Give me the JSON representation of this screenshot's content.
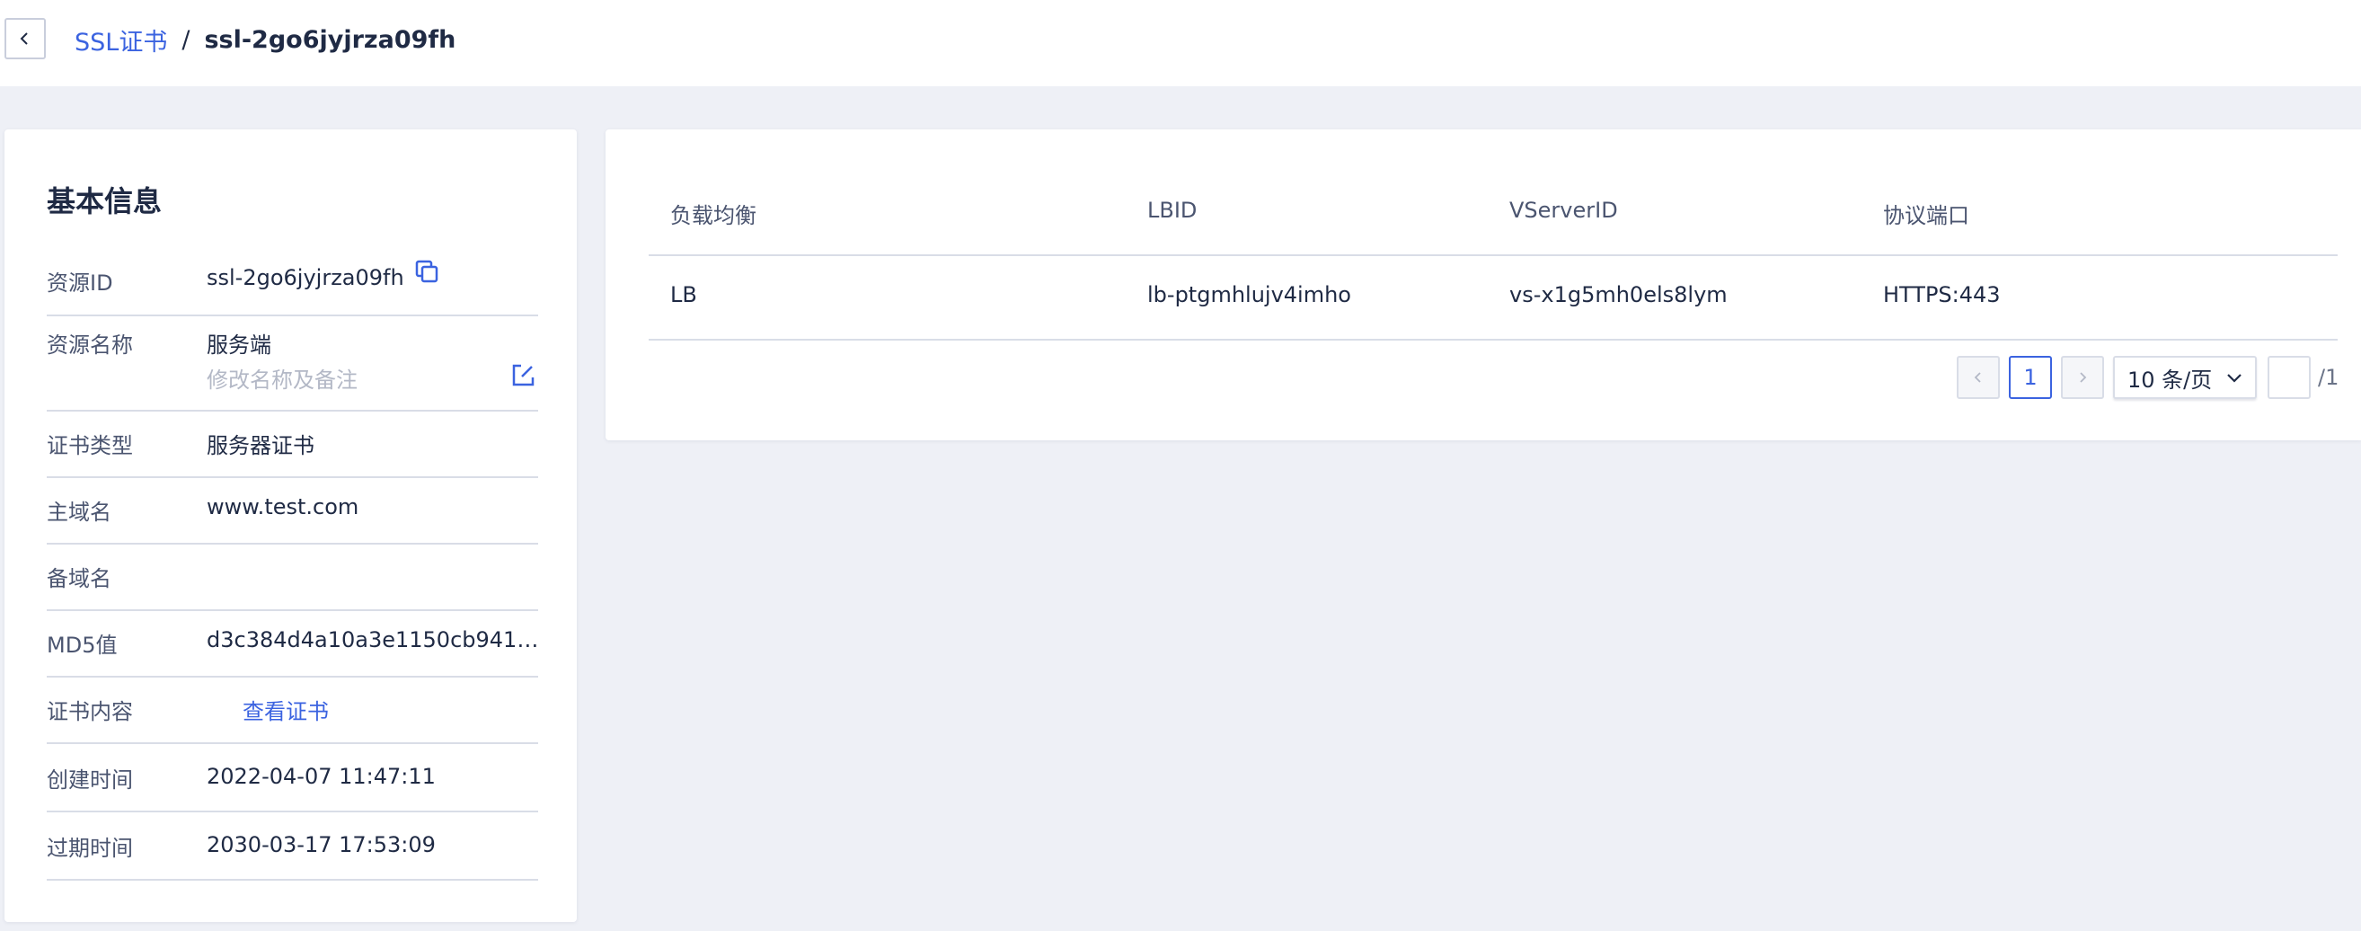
{
  "header": {
    "back_icon": "chevron-left-icon",
    "breadcrumb_parent": "SSL证书",
    "breadcrumb_separator": "/",
    "breadcrumb_current": "ssl-2go6jyjrza09fh"
  },
  "info": {
    "title": "基本信息",
    "rows": {
      "resource_id": {
        "label": "资源ID",
        "value": "ssl-2go6jyjrza09fh"
      },
      "resource_name": {
        "label": "资源名称",
        "value": "服务端",
        "hint": "修改名称及备注"
      },
      "cert_type": {
        "label": "证书类型",
        "value": "服务器证书"
      },
      "main_domain": {
        "label": "主域名",
        "value": "www.test.com"
      },
      "backup_domain": {
        "label": "备域名",
        "value": ""
      },
      "md5": {
        "label": "MD5值",
        "value": "d3c384d4a10a3e1150cb941b..."
      },
      "content": {
        "label": "证书内容",
        "link": "查看证书"
      },
      "created": {
        "label": "创建时间",
        "value": "2022-04-07 11:47:11"
      },
      "expires": {
        "label": "过期时间",
        "value": "2030-03-17 17:53:09"
      }
    }
  },
  "table": {
    "columns": [
      "负载均衡",
      "LBID",
      "VServerID",
      "协议端口"
    ],
    "rows": [
      [
        "LB",
        "lb-ptgmhlujv4imho",
        "vs-x1g5mh0els8lym",
        "HTTPS:443"
      ]
    ]
  },
  "pagination": {
    "current_page": "1",
    "page_size": "10 条/页",
    "total_pages": "/1"
  },
  "colors": {
    "accent": "#3b63e0",
    "background": "#eef0f6",
    "text": "#1f2a44"
  }
}
